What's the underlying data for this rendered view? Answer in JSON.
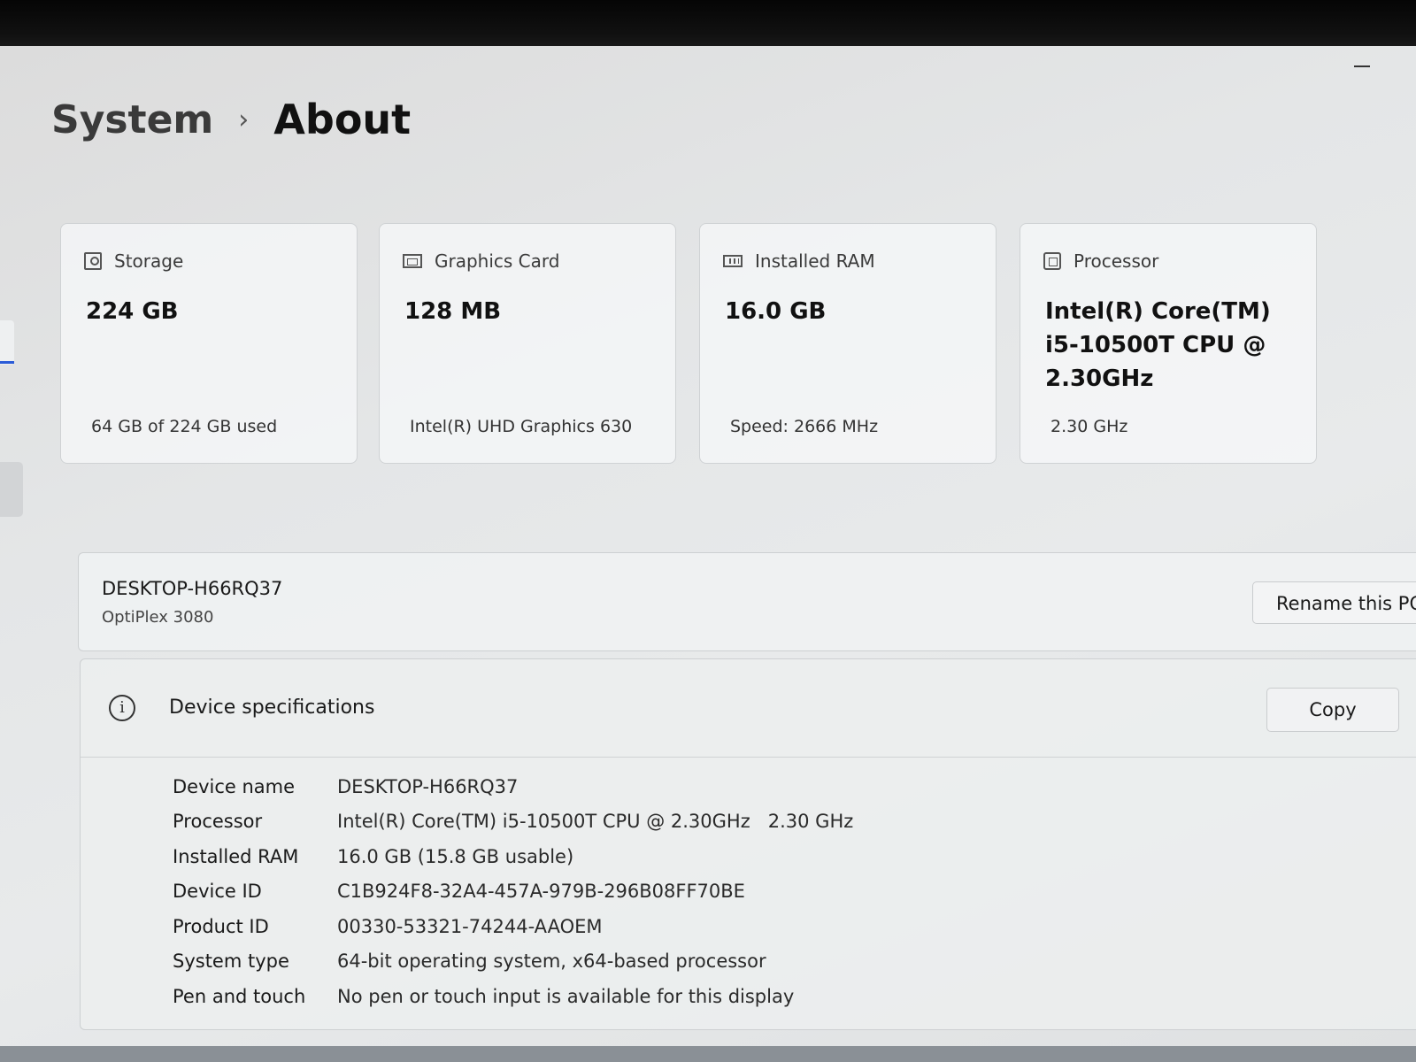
{
  "breadcrumb": {
    "parent": "System",
    "separator": "›",
    "current": "About"
  },
  "cards": [
    {
      "label": "Storage",
      "icon": "storage-icon",
      "value": "224 GB",
      "sub": "64 GB of 224 GB used"
    },
    {
      "label": "Graphics Card",
      "icon": "graphics-card-icon",
      "value": "128 MB",
      "sub": "Intel(R) UHD Graphics 630"
    },
    {
      "label": "Installed RAM",
      "icon": "ram-icon",
      "value": "16.0 GB",
      "sub": "Speed: 2666 MHz"
    },
    {
      "label": "Processor",
      "icon": "processor-icon",
      "value": "Intel(R) Core(TM) i5-10500T CPU @ 2.30GHz",
      "sub": "2.30 GHz"
    }
  ],
  "pc": {
    "name": "DESKTOP-H66RQ37",
    "model": "OptiPlex 3080",
    "rename_label": "Rename this PC"
  },
  "specs": {
    "title": "Device specifications",
    "copy_label": "Copy",
    "info_glyph": "i",
    "rows": [
      {
        "label": "Device name",
        "value": "DESKTOP-H66RQ37"
      },
      {
        "label": "Processor",
        "value": "Intel(R) Core(TM) i5-10500T CPU @ 2.30GHz   2.30 GHz"
      },
      {
        "label": "Installed RAM",
        "value": "16.0 GB (15.8 GB usable)"
      },
      {
        "label": "Device ID",
        "value": "C1B924F8-32A4-457A-979B-296B08FF70BE"
      },
      {
        "label": "Product ID",
        "value": "00330-53321-74244-AAOEM"
      },
      {
        "label": "System type",
        "value": "64-bit operating system, x64-based processor"
      },
      {
        "label": "Pen and touch",
        "value": "No pen or touch input is available for this display"
      }
    ]
  }
}
